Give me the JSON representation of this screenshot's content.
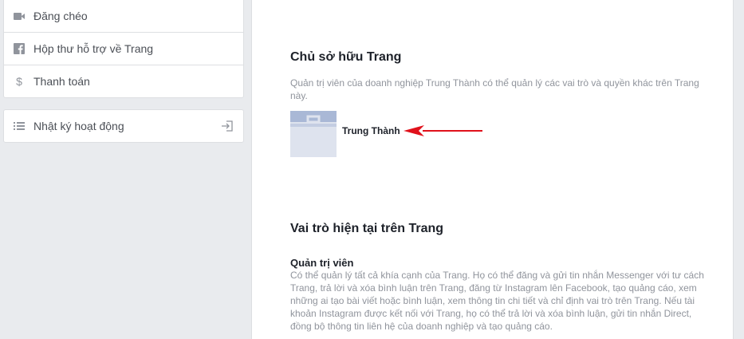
{
  "sidebar": {
    "items": [
      {
        "label": "Đăng chéo",
        "icon": "video-icon"
      },
      {
        "label": "Hộp thư hỗ trợ về Trang",
        "icon": "facebook-icon"
      },
      {
        "label": "Thanh toán",
        "icon": "dollar-icon"
      }
    ],
    "activity_log": {
      "label": "Nhật ký hoạt động",
      "icon": "list-icon",
      "action_icon": "enter-icon"
    }
  },
  "owner_section": {
    "title": "Chủ sở hữu Trang",
    "description": "Quản trị viên của doanh nghiệp Trung Thành có thể quản lý các vai trò và quyền khác trên Trang này.",
    "owner_name": "Trung Thành",
    "owner_icon": "briefcase-icon"
  },
  "roles_section": {
    "title": "Vai trò hiện tại trên Trang",
    "role_title": "Quản trị viên",
    "role_description": "Có thể quản lý tất cả khía cạnh của Trang. Họ có thể đăng và gửi tin nhắn Messenger với tư cách Trang, trả lời và xóa bình luận trên Trang, đăng từ Instagram lên Facebook, tạo quảng cáo, xem những ai tạo bài viết hoặc bình luận, xem thông tin chi tiết và chỉ định vai trò trên Trang. Nếu tài khoản Instagram được kết nối với Trang, họ có thể trả lời và xóa bình luận, gửi tin nhắn Direct, đồng bộ thông tin liên hệ của doanh nghiệp và tạo quảng cáo."
  },
  "colors": {
    "page_bg": "#e9ebee",
    "icon_gray": "#90949c",
    "thumb_bg": "#a9b8d6",
    "arrow_red": "#e0111b"
  }
}
